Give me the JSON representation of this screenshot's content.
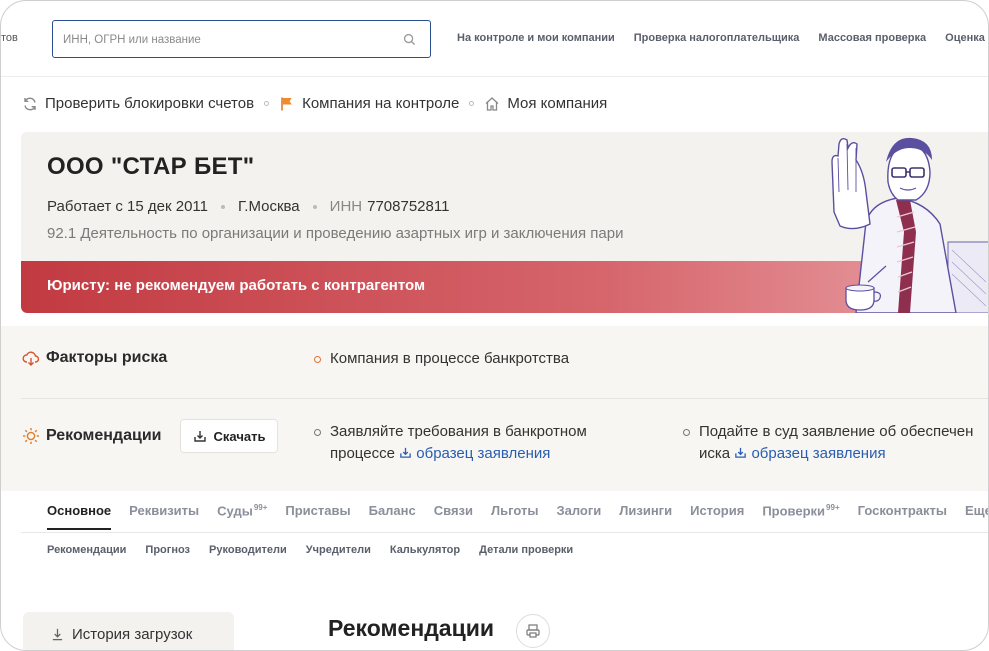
{
  "topnav": {
    "cut_left": "тов",
    "search_placeholder": "ИНН, ОГРН или название",
    "links": [
      "На контроле и мои компании",
      "Проверка налогоплательщика",
      "Массовая проверка",
      "Оценка"
    ]
  },
  "actions": {
    "check_blocks": "Проверить блокировки счетов",
    "on_control": "Компания на контроле",
    "my_company": "Моя компания"
  },
  "company": {
    "name": "ООО \"СТАР БЕТ\"",
    "works_since": "Работает с 15 дек 2011",
    "city": "Г.Москва",
    "inn_label": "ИНН",
    "inn_value": "7708752811",
    "okved": "92.1 Деятельность по организации и проведению азартных игр и заключения пари",
    "warning": "Юристу: не рекомендуем работать с контрагентом"
  },
  "risk": {
    "title": "Факторы риска",
    "items": [
      "Компания в процессе банкротства"
    ]
  },
  "recommendations": {
    "title": "Рекомендации",
    "download_label": "Скачать",
    "items": [
      {
        "line1": "Заявляйте требования в банкротном",
        "line2": "процессе",
        "link": "образец заявления"
      },
      {
        "line1": "Подайте в суд заявление об обеспечен",
        "line2": "иска",
        "link": "образец заявления"
      }
    ]
  },
  "tabs": {
    "items": [
      {
        "label": "Основное",
        "sup": ""
      },
      {
        "label": "Реквизиты",
        "sup": ""
      },
      {
        "label": "Суды",
        "sup": "99+"
      },
      {
        "label": "Приставы",
        "sup": ""
      },
      {
        "label": "Баланс",
        "sup": ""
      },
      {
        "label": "Связи",
        "sup": ""
      },
      {
        "label": "Льготы",
        "sup": ""
      },
      {
        "label": "Залоги",
        "sup": ""
      },
      {
        "label": "Лизинги",
        "sup": ""
      },
      {
        "label": "История",
        "sup": ""
      },
      {
        "label": "Проверки",
        "sup": "99+"
      },
      {
        "label": "Госконтракты",
        "sup": ""
      },
      {
        "label": "Еще",
        "sup": ""
      }
    ],
    "active": "Основное"
  },
  "subtabs": [
    "Рекомендации",
    "Прогноз",
    "Руководители",
    "Учредители",
    "Калькулятор",
    "Детали проверки"
  ],
  "bottom": {
    "history_label": "История загрузок",
    "heading": "Рекомендации"
  },
  "colors": {
    "accent_blue": "#2a5db0",
    "warning_red": "#c23a41",
    "risk_orange": "#e0733f",
    "card_bg": "#f3f2ef"
  }
}
